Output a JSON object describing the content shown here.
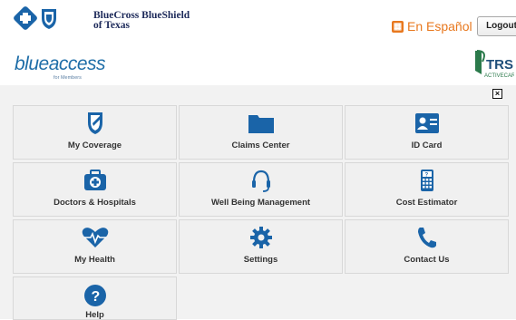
{
  "header": {
    "bcbs_name_line1": "BlueCross BlueShield",
    "bcbs_name_line2": "of Texas",
    "espanol_label": "En Español",
    "logout_label": "Logout"
  },
  "brand": {
    "blueaccess": "blueaccess",
    "blueaccess_sub": "for Members",
    "trs_logo": "TRS",
    "trs_sub": "ACTIVECARE"
  },
  "tiles": [
    {
      "label": "My Coverage",
      "icon": "shield-icon"
    },
    {
      "label": "Claims Center",
      "icon": "folder-icon"
    },
    {
      "label": "ID Card",
      "icon": "id-card-icon"
    },
    {
      "label": "Doctors & Hospitals",
      "icon": "medical-bag-icon"
    },
    {
      "label": "Well Being Management",
      "icon": "headset-icon"
    },
    {
      "label": "Cost Estimator",
      "icon": "calculator-icon"
    },
    {
      "label": "My Health",
      "icon": "heart-pulse-icon"
    },
    {
      "label": "Settings",
      "icon": "gear-icon"
    },
    {
      "label": "Contact Us",
      "icon": "phone-icon"
    },
    {
      "label": "Help",
      "icon": "help-icon"
    }
  ],
  "colors": {
    "icon_blue": "#1a64a8",
    "accent_orange": "#e8781e",
    "tile_bg": "#f0f0f0"
  }
}
